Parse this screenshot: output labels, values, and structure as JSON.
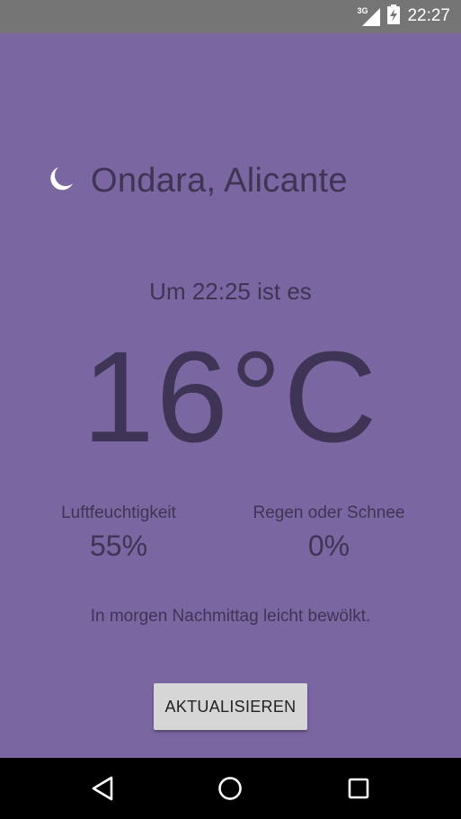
{
  "status_bar": {
    "network_type": "3G",
    "time": "22:27",
    "icons": [
      "signal-icon",
      "battery-charging-icon"
    ]
  },
  "weather": {
    "condition_icon": "moon-icon",
    "location": "Ondara, Alicante",
    "time_caption": "Um 22:25 ist es",
    "temperature": "16°C",
    "humidity": {
      "label": "Luftfeuchtigkeit",
      "value": "55%"
    },
    "precipitation": {
      "label": "Regen oder Schnee",
      "value": "0%"
    },
    "forecast": "In morgen Nachmittag leicht bewölkt.",
    "refresh_label": "AKTUALISIEREN"
  },
  "navigation": {
    "buttons": [
      "back-icon",
      "home-icon",
      "recents-icon"
    ]
  },
  "colors": {
    "background": "#7a66a0",
    "text": "#3e3456",
    "button": "#d6d6d6",
    "status_bar": "#757575",
    "nav_bar": "#000000"
  }
}
